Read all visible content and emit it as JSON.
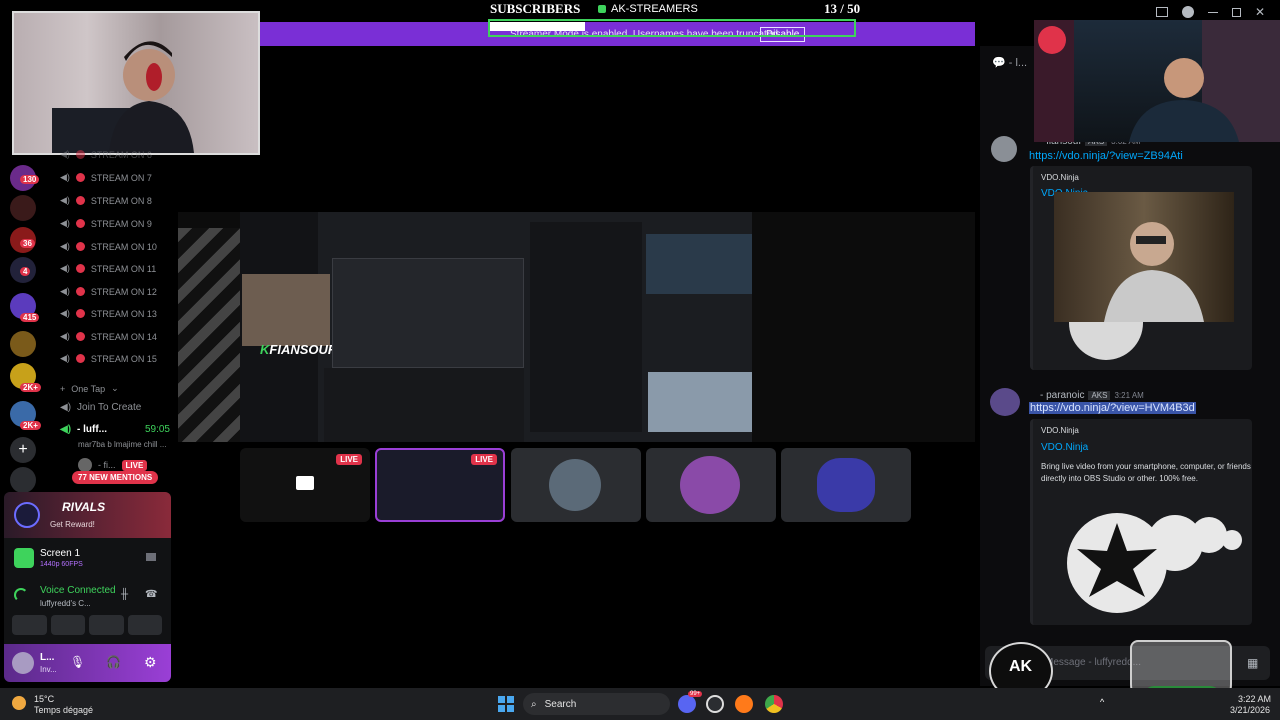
{
  "overlay": {
    "subscribers_label": "SUBSCRIBERS",
    "channel": "AK-STREAMERS",
    "count": "13 / 50",
    "streamer_mode_text": "Streamer Mode is enabled. Usernames have been truncated.",
    "disable_label": "Disable"
  },
  "guild_badges": [
    "130",
    "36",
    "4",
    "415",
    "2K+",
    "2K+"
  ],
  "stream_channels": [
    "STREAM ON 6",
    "STREAM ON 7",
    "STREAM ON 8",
    "STREAM ON 9",
    "STREAM ON 10",
    "STREAM ON 11",
    "STREAM ON 12",
    "STREAM ON 13",
    "STREAM ON 14",
    "STREAM ON 15"
  ],
  "channel_list": {
    "one_tap": "One Tap",
    "join_to_create": "Join To Create",
    "voice_user": "- luff...",
    "voice_timer": "59:05",
    "voice_status": "mar7ba b lmajime chill ...",
    "live_user": "- fi...",
    "live_label": "LIVE",
    "mentions": "77 NEW MENTIONS"
  },
  "panel": {
    "promo_title": "RIVALS",
    "promo_cta": "Get Reward!",
    "screen_title": "Screen 1",
    "screen_quality": "1440p 60FPS",
    "voice_connected": "Voice Connected",
    "voice_channel": "luffyredd's C...",
    "user_name": "L...",
    "user_status": "Inv..."
  },
  "stream": {
    "thumbnails_live": "LIVE",
    "inner_brand": "FIANSOUF"
  },
  "chat": {
    "header": "- l...",
    "msg1_author": "- fiansouf",
    "msg1_tag": "AKS",
    "msg1_time": "3:02 AM",
    "msg1_link": "https://vdo.ninja/?view=ZB94Ati",
    "msg2_author": "- paranoic",
    "msg2_tag": "AKS",
    "msg2_time": "3:21 AM",
    "msg2_link": "https://vdo.ninja/?view=HVM4B3d",
    "embed_site": "VDO.Ninja",
    "embed_title": "VDO.Ninja",
    "embed_desc": "Bring live video from your smartphone, computer, or friends directly into OBS Studio or other. 100% free.",
    "input_placeholder": "Message - luffyredd..."
  },
  "taskbar": {
    "weather_temp": "15°C",
    "weather_desc": "Temps dégagé",
    "search_label": "Search",
    "time": "3:22 AM",
    "date": "3/21/2026",
    "notif_count": "99+"
  },
  "colors": {
    "purple": "#7a2fd6",
    "green": "#3ed35c",
    "red": "#e0334a",
    "link": "#00a8fc"
  }
}
